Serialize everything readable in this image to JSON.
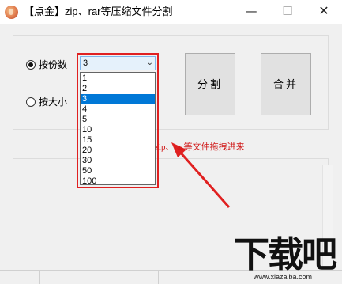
{
  "window": {
    "title": "【点金】zip、rar等压缩文件分割",
    "minimize_glyph": "—",
    "maximize_glyph": "☐",
    "close_glyph": "✕"
  },
  "options": {
    "by_count_label": "按份数",
    "by_size_label": "按大小",
    "selected": "按份数"
  },
  "count_select": {
    "value": "3",
    "arrow_glyph": "⌄",
    "options": [
      "1",
      "2",
      "3",
      "4",
      "5",
      "10",
      "15",
      "20",
      "30",
      "50",
      "100"
    ],
    "highlighted": "3"
  },
  "buttons": {
    "split_label": "分割",
    "merge_label": "合并"
  },
  "drop_hint": "zip、rar等文件拖拽进来",
  "watermark": {
    "main": "下载吧",
    "url": "www.xiazaiba.com"
  },
  "colors": {
    "accent_red": "#e02020",
    "selection_blue": "#0078d7",
    "hint_text": "#d01818"
  }
}
